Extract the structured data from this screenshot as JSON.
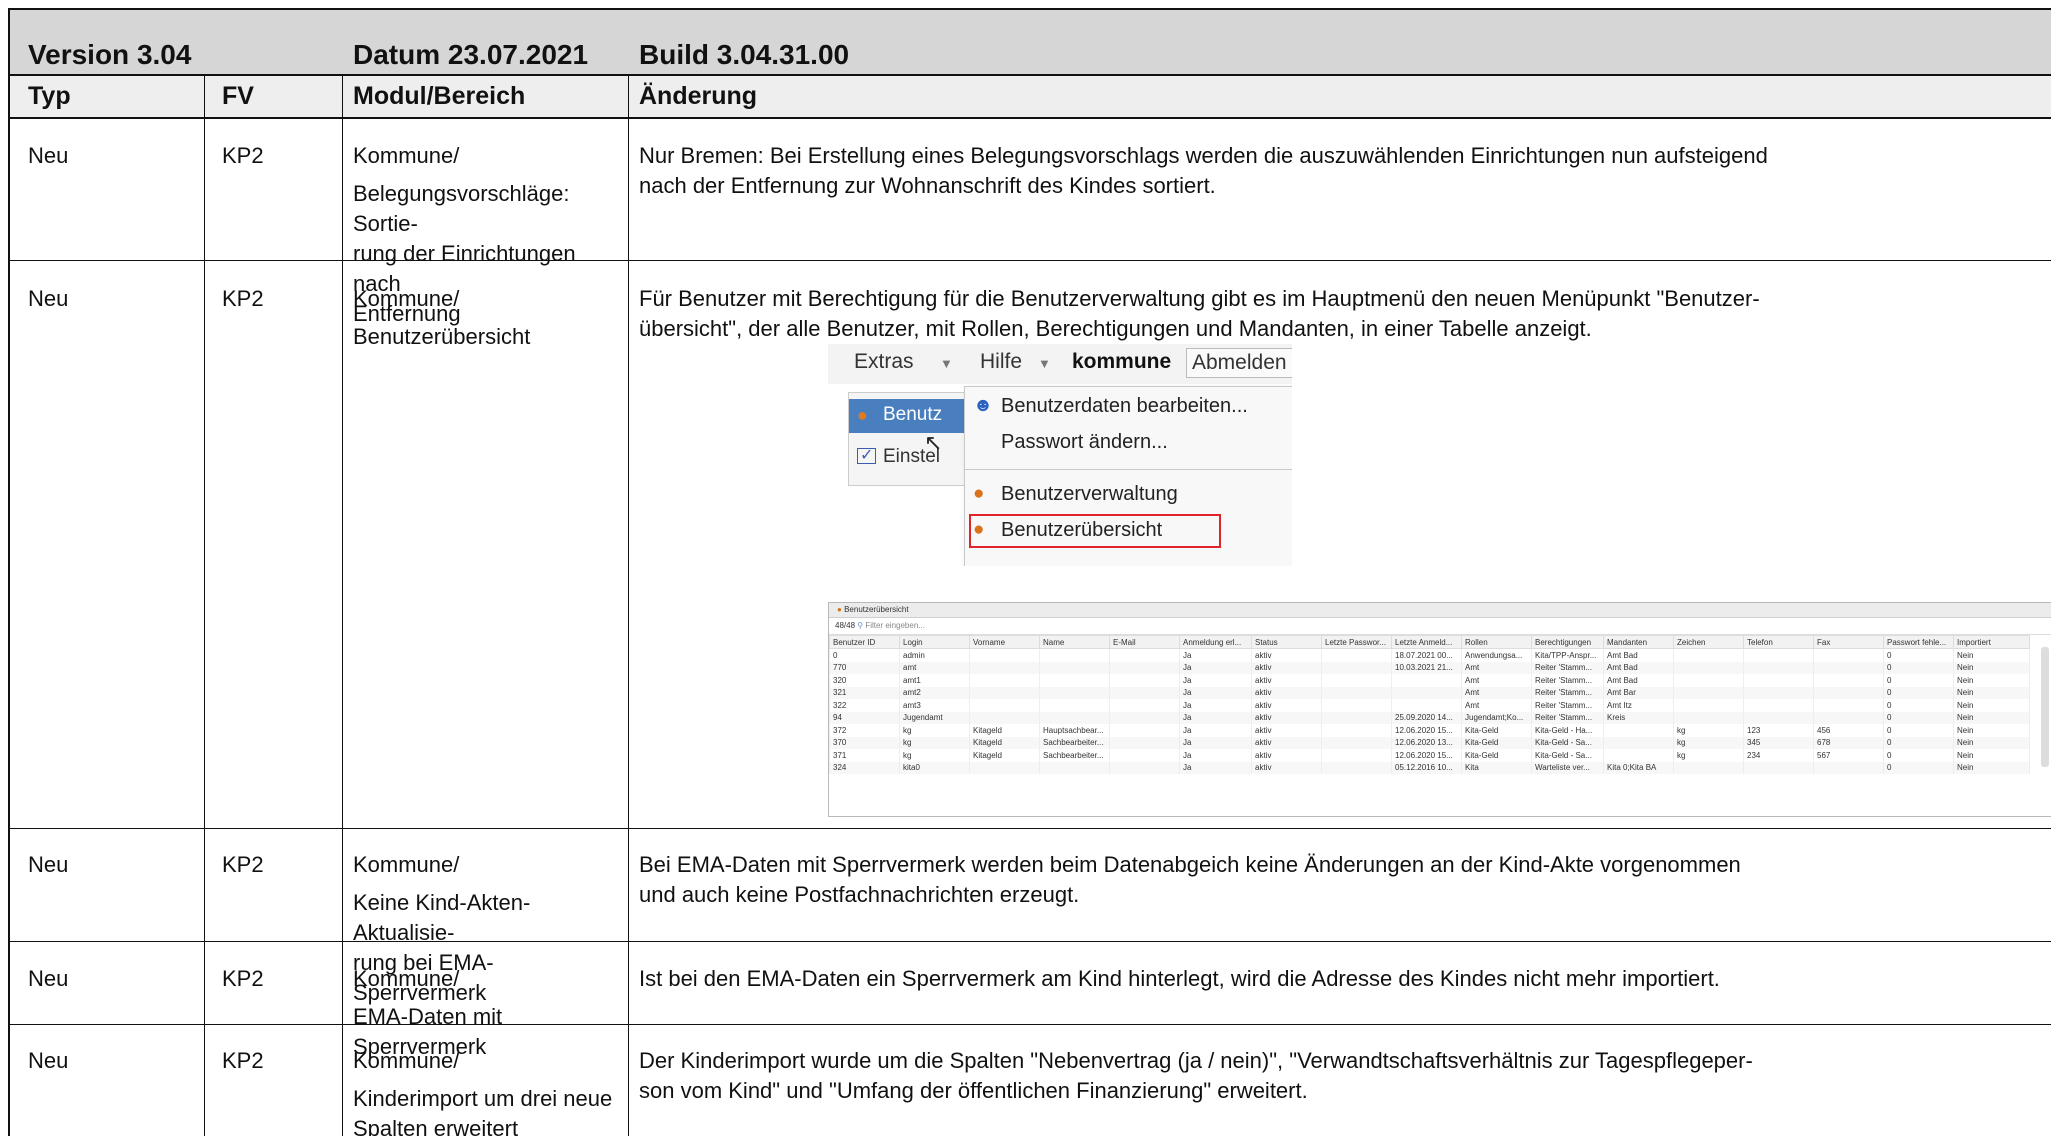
{
  "header": {
    "version": "Version 3.04",
    "datum": "Datum 23.07.2021",
    "build": "Build 3.04.31.00"
  },
  "columns": [
    "Typ",
    "FV",
    "Modul/Bereich",
    "Änderung"
  ],
  "rows": [
    {
      "typ": "Neu",
      "fv": "KP2",
      "modul": [
        "Kommune/",
        "Belegungsvorschläge: Sortie-",
        "rung der Einrichtungen nach",
        "Entfernung"
      ],
      "aenderung": [
        "Nur Bremen: Bei Erstellung eines Belegungsvorschlags werden die auszuwählenden Einrichtungen nun aufsteigend",
        "nach der Entfernung zur Wohnanschrift des Kindes sortiert."
      ]
    },
    {
      "typ": "Neu",
      "fv": "KP2",
      "modul": [
        "Kommune/",
        "Benutzerübersicht"
      ],
      "aenderung": [
        "Für Benutzer mit Berechtigung für die Benutzerverwaltung gibt es im Hauptmenü den neuen Menüpunkt \"Benutzer-",
        "übersicht\", der alle Benutzer, mit Rollen, Berechtigungen und Mandanten, in einer Tabelle anzeigt."
      ]
    },
    {
      "typ": "Neu",
      "fv": "KP2",
      "modul": [
        "Kommune/",
        "Keine Kind-Akten-Aktualisie-",
        "rung bei EMA-Sperrvermerk"
      ],
      "aenderung": [
        "Bei EMA-Daten mit Sperrvermerk werden beim Datenabgeich keine Änderungen an der Kind-Akte vorgenommen",
        "und auch keine Postfachnachrichten erzeugt."
      ]
    },
    {
      "typ": "Neu",
      "fv": "KP2",
      "modul": [
        "Kommune/",
        "EMA-Daten mit Sperrvermerk"
      ],
      "aenderung": [
        "Ist bei den EMA-Daten ein Sperrvermerk am Kind hinterlegt, wird die Adresse des Kindes nicht mehr importiert."
      ]
    },
    {
      "typ": "Neu",
      "fv": "KP2",
      "modul": [
        "Kommune/",
        "Kinderimport um drei neue",
        "Spalten erweitert"
      ],
      "aenderung": [
        "Der Kinderimport wurde um die Spalten \"Nebenvertrag (ja / nein)\", \"Verwandtschaftsverhältnis zur Tagespflegeper-",
        "son vom Kind\" und \"Umfang der öffentlichen Finanzierung\" erweitert."
      ]
    }
  ],
  "menu_screenshot": {
    "bar": {
      "extras": "Extras",
      "hilfe": "Hilfe",
      "user": "kommune",
      "logout": "Abmelden"
    },
    "left_items": [
      "Benutz",
      "Einstel"
    ],
    "items": [
      "Benutzerdaten bearbeiten...",
      "Passwort ändern...",
      "Benutzerverwaltung",
      "Benutzerübersicht"
    ],
    "highlight_color": "#e0242a"
  },
  "table_screenshot": {
    "title": "Benutzerübersicht",
    "count": "48/48",
    "filter_placeholder": "Filter eingeben...",
    "headers": [
      "Benutzer ID",
      "Login",
      "Vorname",
      "Name",
      "E-Mail",
      "Anmeldung erl...",
      "Status",
      "Letzte Passwor...",
      "Letzte Anmeld...",
      "Rollen",
      "Berechtigungen",
      "Mandanten",
      "Zeichen",
      "Telefon",
      "Fax",
      "Passwort fehle...",
      "Importiert"
    ],
    "rows": [
      [
        "0",
        "admin",
        "",
        "",
        "",
        "Ja",
        "aktiv",
        "",
        "18.07.2021 00...",
        "Anwendungsa...",
        "Kita/TPP-Anspr...",
        "Amt Bad",
        "",
        "",
        "",
        "0",
        "Nein"
      ],
      [
        "770",
        "amt",
        "",
        "",
        "",
        "Ja",
        "aktiv",
        "",
        "10.03.2021 21...",
        "Amt",
        "Reiter 'Stamm...",
        "Amt Bad",
        "",
        "",
        "",
        "0",
        "Nein"
      ],
      [
        "320",
        "amt1",
        "",
        "",
        "",
        "Ja",
        "aktiv",
        "",
        "",
        "Amt",
        "Reiter 'Stamm...",
        "Amt Bad",
        "",
        "",
        "",
        "0",
        "Nein"
      ],
      [
        "321",
        "amt2",
        "",
        "",
        "",
        "Ja",
        "aktiv",
        "",
        "",
        "Amt",
        "Reiter 'Stamm...",
        "Amt Bar",
        "",
        "",
        "",
        "0",
        "Nein"
      ],
      [
        "322",
        "amt3",
        "",
        "",
        "",
        "Ja",
        "aktiv",
        "",
        "",
        "Amt",
        "Reiter 'Stamm...",
        "Amt Itz",
        "",
        "",
        "",
        "0",
        "Nein"
      ],
      [
        "94",
        "Jugendamt",
        "",
        "",
        "",
        "Ja",
        "aktiv",
        "",
        "25.09.2020 14...",
        "Jugendamt;Ko...",
        "Reiter 'Stamm...",
        "Kreis",
        "",
        "",
        "",
        "0",
        "Nein"
      ],
      [
        "372",
        "kg",
        "Kitageld",
        "Hauptsachbear...",
        "",
        "Ja",
        "aktiv",
        "",
        "12.06.2020 15...",
        "Kita-Geld",
        "Kita-Geld - Ha...",
        "",
        "kg",
        "123",
        "456",
        "0",
        "Nein"
      ],
      [
        "370",
        "kg",
        "Kitageld",
        "Sachbearbeiter...",
        "",
        "Ja",
        "aktiv",
        "",
        "12.06.2020 13...",
        "Kita-Geld",
        "Kita-Geld - Sa...",
        "",
        "kg",
        "345",
        "678",
        "0",
        "Nein"
      ],
      [
        "371",
        "kg",
        "Kitageld",
        "Sachbearbeiter...",
        "",
        "Ja",
        "aktiv",
        "",
        "12.06.2020 15...",
        "Kita-Geld",
        "Kita-Geld - Sa...",
        "",
        "kg",
        "234",
        "567",
        "0",
        "Nein"
      ],
      [
        "324",
        "kita0",
        "",
        "",
        "",
        "Ja",
        "aktiv",
        "",
        "05.12.2016 10...",
        "Kita",
        "Warteliste ver...",
        "Kita 0;Kita BA",
        "",
        "",
        "",
        "0",
        "Nein"
      ]
    ]
  }
}
